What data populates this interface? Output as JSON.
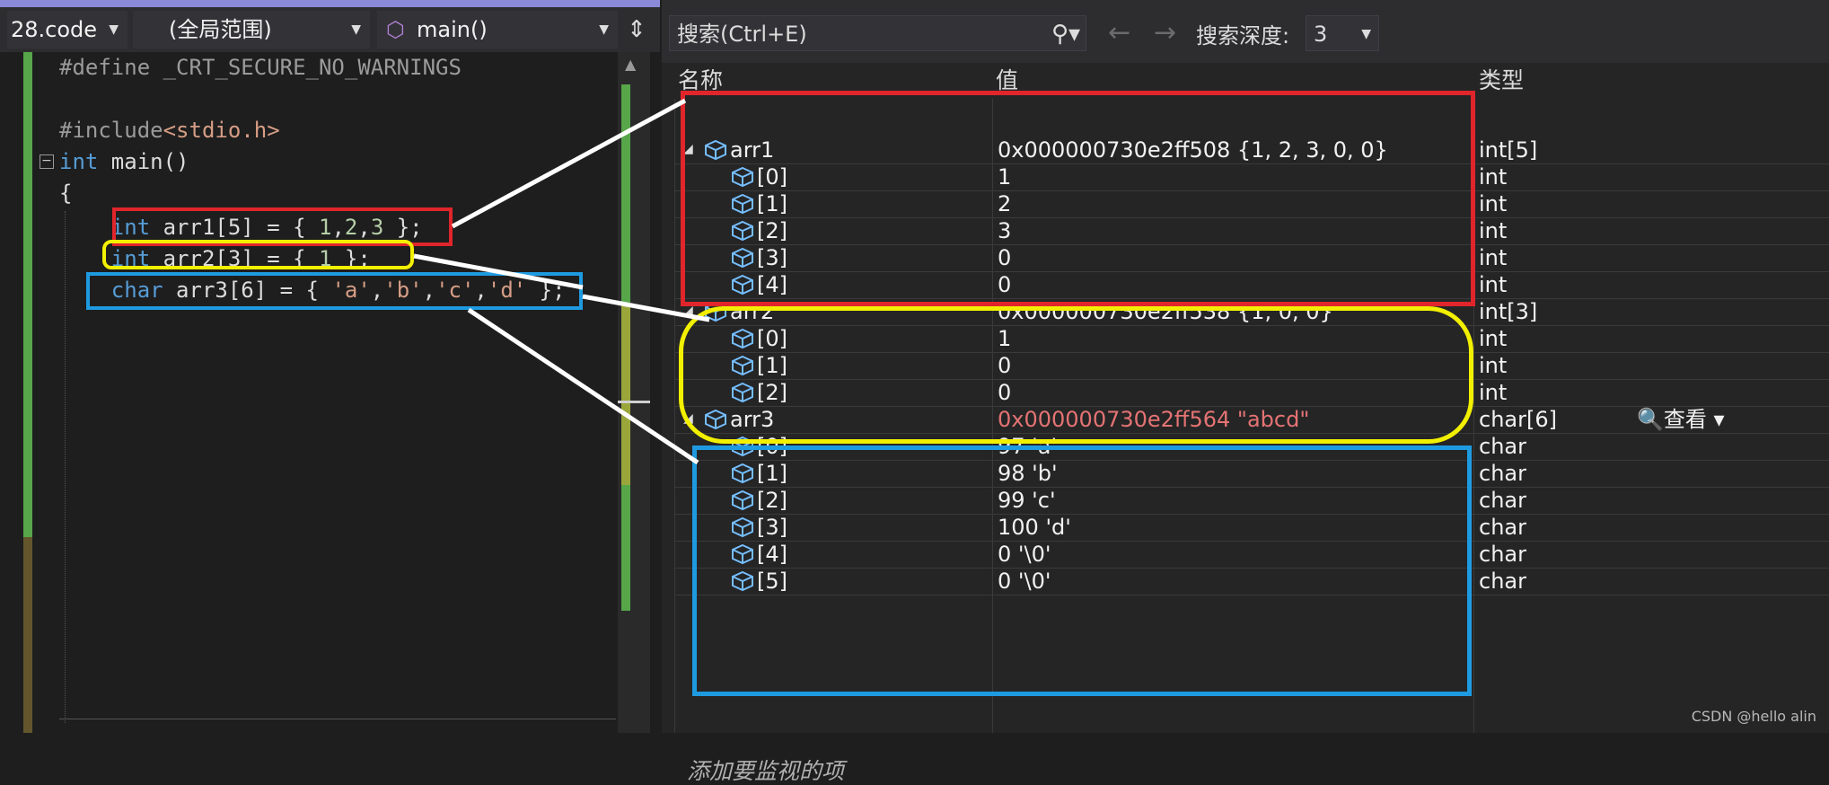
{
  "editor": {
    "file_dropdown": "28.code",
    "scope_dropdown": "(全局范围)",
    "function_dropdown": "main()",
    "lines": [
      {
        "tokens": [
          {
            "t": "#define ",
            "c": "pp"
          },
          {
            "t": "_CRT_SECURE_NO_WARNINGS",
            "c": "pp"
          }
        ]
      },
      {
        "tokens": []
      },
      {
        "tokens": [
          {
            "t": "#include",
            "c": "pp"
          },
          {
            "t": "<stdio.h>",
            "c": "str"
          }
        ]
      },
      {
        "tokens": [
          {
            "t": "int",
            "c": "kw"
          },
          {
            "t": " main()",
            "c": ""
          }
        ]
      },
      {
        "tokens": [
          {
            "t": "{",
            "c": ""
          }
        ]
      },
      {
        "tokens": [
          {
            "t": "    int",
            "c": "kw"
          },
          {
            "t": " arr1[5] = { ",
            "c": ""
          },
          {
            "t": "1",
            "c": "num"
          },
          {
            "t": ",",
            "c": ""
          },
          {
            "t": "2",
            "c": "num"
          },
          {
            "t": ",",
            "c": ""
          },
          {
            "t": "3",
            "c": "num"
          },
          {
            "t": " };",
            "c": ""
          }
        ]
      },
      {
        "tokens": [
          {
            "t": "    int",
            "c": "kw"
          },
          {
            "t": " arr2[3] = { ",
            "c": ""
          },
          {
            "t": "1",
            "c": "num"
          },
          {
            "t": " };",
            "c": ""
          }
        ]
      },
      {
        "tokens": [
          {
            "t": "    char",
            "c": "kw"
          },
          {
            "t": " arr3[6] = { ",
            "c": ""
          },
          {
            "t": "'a'",
            "c": "str"
          },
          {
            "t": ",",
            "c": ""
          },
          {
            "t": "'b'",
            "c": "str"
          },
          {
            "t": ",",
            "c": ""
          },
          {
            "t": "'c'",
            "c": "str"
          },
          {
            "t": ",",
            "c": ""
          },
          {
            "t": "'d'",
            "c": "str"
          },
          {
            "t": " };",
            "c": ""
          }
        ]
      }
    ]
  },
  "watch": {
    "search_placeholder": "搜索(Ctrl+E)",
    "search_depth_label": "搜索深度:",
    "search_depth_value": "3",
    "columns": {
      "name": "名称",
      "value": "值",
      "type": "类型"
    },
    "rows": [
      {
        "name": "arr1",
        "value": "0x000000730e2ff508 {1, 2, 3, 0, 0}",
        "type": "int[5]",
        "level": 0,
        "expanded": true
      },
      {
        "name": "[0]",
        "value": "1",
        "type": "int",
        "level": 1
      },
      {
        "name": "[1]",
        "value": "2",
        "type": "int",
        "level": 1
      },
      {
        "name": "[2]",
        "value": "3",
        "type": "int",
        "level": 1
      },
      {
        "name": "[3]",
        "value": "0",
        "type": "int",
        "level": 1
      },
      {
        "name": "[4]",
        "value": "0",
        "type": "int",
        "level": 1
      },
      {
        "name": "arr2",
        "value": "0x000000730e2ff538 {1, 0, 0}",
        "type": "int[3]",
        "level": 0,
        "expanded": true
      },
      {
        "name": "[0]",
        "value": "1",
        "type": "int",
        "level": 1
      },
      {
        "name": "[1]",
        "value": "0",
        "type": "int",
        "level": 1
      },
      {
        "name": "[2]",
        "value": "0",
        "type": "int",
        "level": 1
      },
      {
        "name": "arr3",
        "value": "0x000000730e2ff564 \"abcd\"",
        "type": "char[6]",
        "level": 0,
        "expanded": true,
        "value_color": "#e57373"
      },
      {
        "name": "[0]",
        "value": "97 'a'",
        "type": "char",
        "level": 1
      },
      {
        "name": "[1]",
        "value": "98 'b'",
        "type": "char",
        "level": 1
      },
      {
        "name": "[2]",
        "value": "99 'c'",
        "type": "char",
        "level": 1
      },
      {
        "name": "[3]",
        "value": "100 'd'",
        "type": "char",
        "level": 1
      },
      {
        "name": "[4]",
        "value": "0 '\\0'",
        "type": "char",
        "level": 1
      },
      {
        "name": "[5]",
        "value": "0 '\\0'",
        "type": "char",
        "level": 1
      }
    ],
    "lookup_label": "查看",
    "add_watch_placeholder": "添加要监视的项"
  },
  "watermark": "CSDN @hello alin",
  "colors": {
    "red": "#e0252b",
    "yellow": "#f2f000",
    "blue": "#1e9ae0",
    "accent": "#57a64a"
  }
}
